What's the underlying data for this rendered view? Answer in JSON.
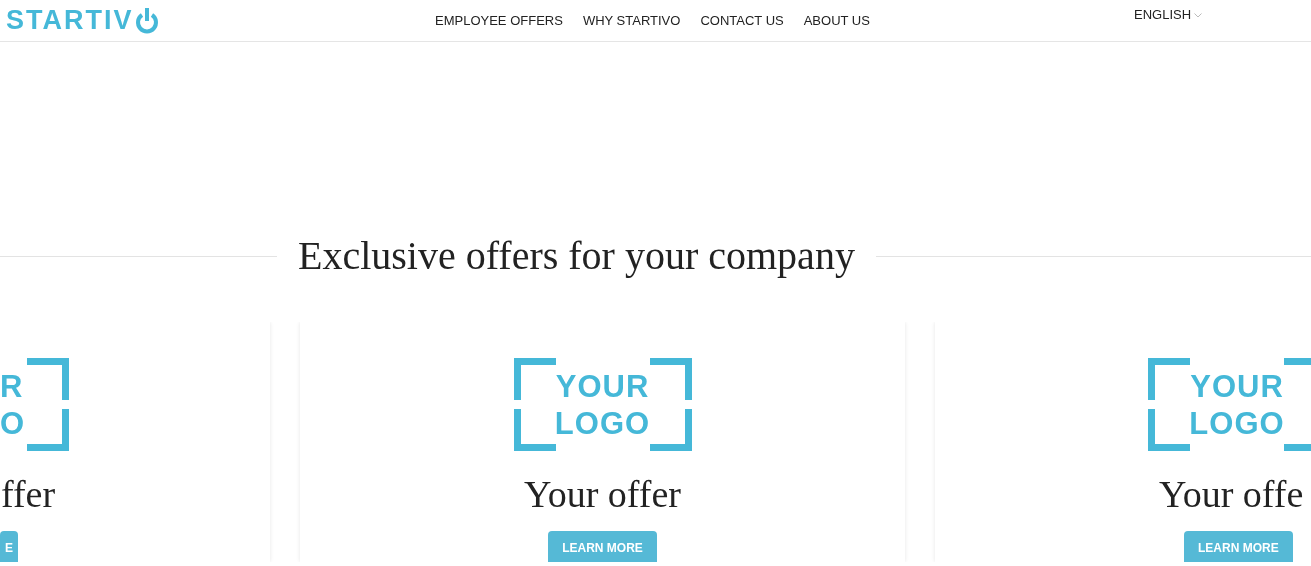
{
  "header": {
    "logo": "STARTIV",
    "nav": [
      {
        "label": "EMPLOYEE OFFERS"
      },
      {
        "label": "WHY STARTIVO"
      },
      {
        "label": "CONTACT US"
      },
      {
        "label": "ABOUT US"
      }
    ],
    "language": "ENGLISH"
  },
  "section": {
    "title": "Exclusive offers for your company"
  },
  "cards": [
    {
      "logo_lines": [
        "R",
        "O"
      ],
      "title": "ffer",
      "button": "E"
    },
    {
      "logo_lines": [
        "YOUR",
        "LOGO"
      ],
      "title": "Your offer",
      "button": "LEARN MORE"
    },
    {
      "logo_lines": [
        "YOUR",
        "LOGO"
      ],
      "title": "Your offe",
      "button": "LEARN MORE"
    }
  ]
}
